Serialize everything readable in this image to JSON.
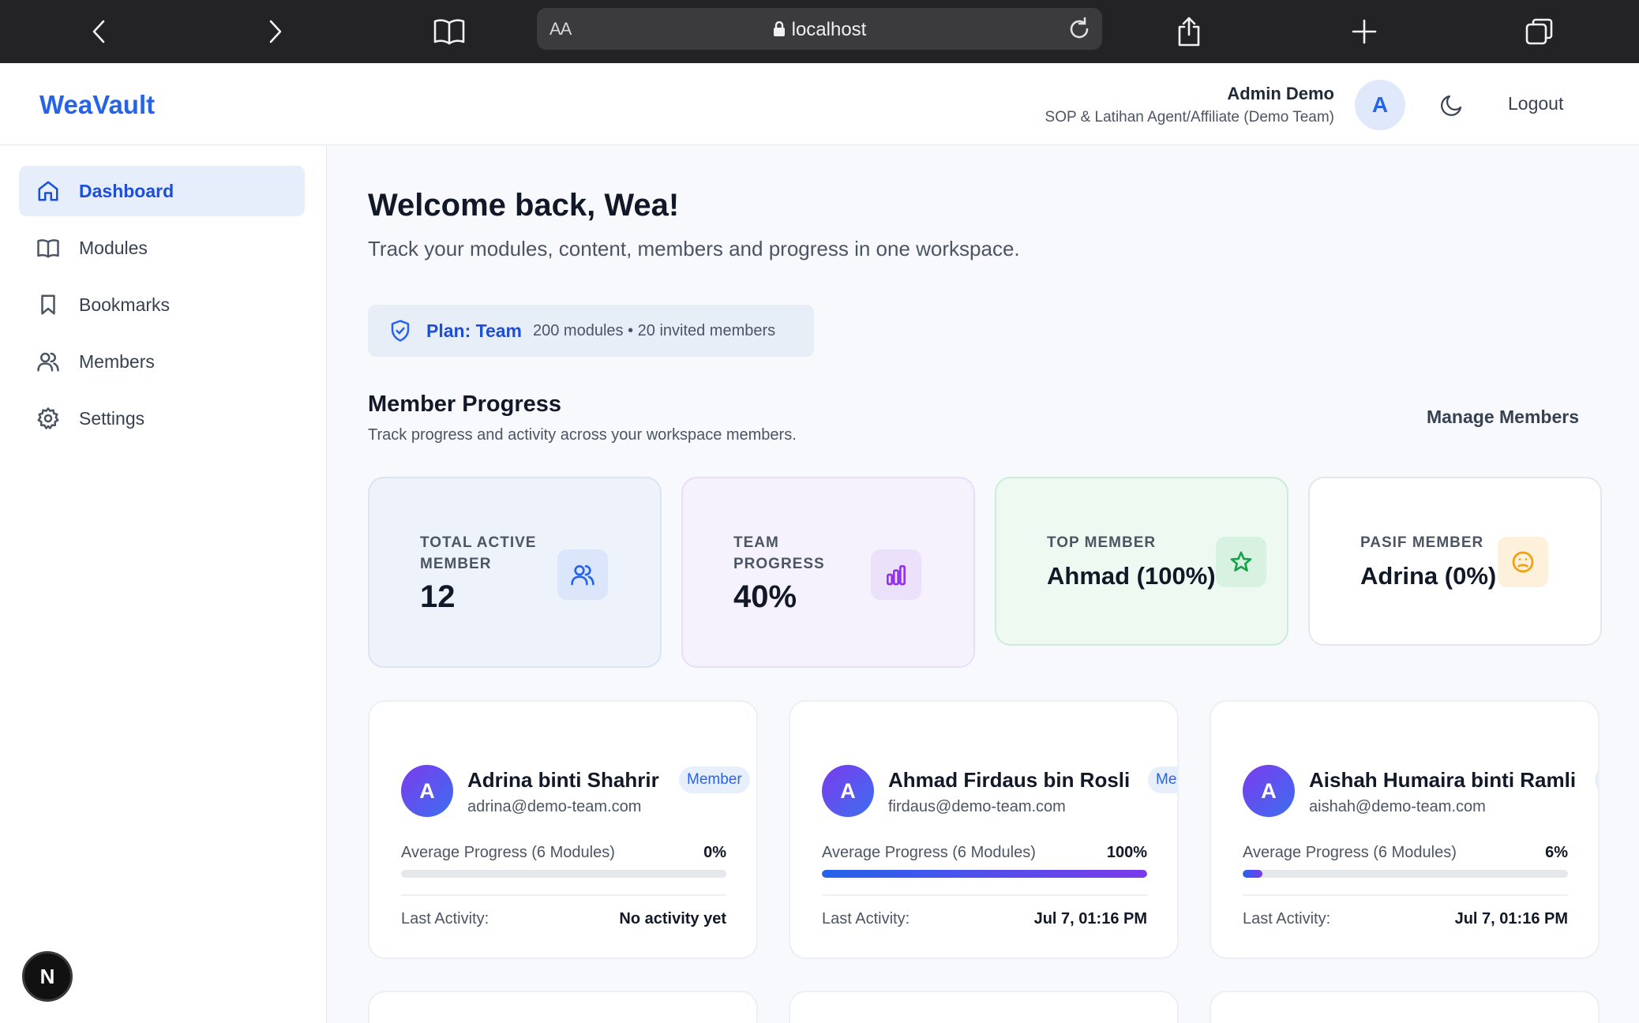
{
  "browser": {
    "url_aa": "AA",
    "host": "localhost"
  },
  "header": {
    "logo": "WeaVault",
    "user_name": "Admin Demo",
    "user_role": "SOP & Latihan Agent/Affiliate (Demo Team)",
    "avatar_initial": "A",
    "logout_label": "Logout"
  },
  "sidebar": {
    "items": [
      {
        "label": "Dashboard",
        "icon": "home-icon",
        "active": true
      },
      {
        "label": "Modules",
        "icon": "book-icon",
        "active": false
      },
      {
        "label": "Bookmarks",
        "icon": "bookmark-icon",
        "active": false
      },
      {
        "label": "Members",
        "icon": "users-icon",
        "active": false
      },
      {
        "label": "Settings",
        "icon": "gear-icon",
        "active": false
      }
    ],
    "fab_label": "N"
  },
  "main": {
    "welcome": "Welcome back, Wea!",
    "subtitle": "Track your modules, content, members and progress in one workspace.",
    "plan_label": "Plan: Team",
    "plan_desc": "200 modules • 20 invited members",
    "section_title": "Member Progress",
    "section_subtitle": "Track progress and activity across your workspace members.",
    "manage_label": "Manage Members"
  },
  "stats": [
    {
      "label": "Total Active Member",
      "value": "12",
      "icon": "users-icon",
      "bg": "#eef3fb",
      "accent": "#2563eb",
      "icon_bg": "#dbe6fa"
    },
    {
      "label": "Team Progress",
      "value": "40%",
      "icon": "bar-chart-icon",
      "bg": "#f5f1fd",
      "accent": "#9333ea",
      "icon_bg": "#ece1fb"
    },
    {
      "label": "Top Member",
      "value": "Ahmad (100%)",
      "icon": "star-icon",
      "bg": "#eef9f2",
      "accent": "#16a34a",
      "icon_bg": "#d7f2e1"
    },
    {
      "label": "Pasif Member",
      "value": "Adrina (0%)",
      "icon": "frown-icon",
      "bg": "#ffffff",
      "accent": "#f59e0b",
      "icon_bg": "#fdf1dc"
    }
  ],
  "members": [
    {
      "initial": "A",
      "name": "Adrina binti Shahrir",
      "email": "adrina@demo-team.com",
      "role": "Member",
      "progress_label": "Average Progress (6 Modules)",
      "progress": 0,
      "progress_text": "0%",
      "last_label": "Last Activity:",
      "last_value": "No activity yet"
    },
    {
      "initial": "A",
      "name": "Ahmad Firdaus bin Rosli",
      "email": "firdaus@demo-team.com",
      "role": "Member",
      "progress_label": "Average Progress (6 Modules)",
      "progress": 100,
      "progress_text": "100%",
      "last_label": "Last Activity:",
      "last_value": "Jul 7, 01:16 PM"
    },
    {
      "initial": "A",
      "name": "Aishah Humaira binti Ramli",
      "email": "aishah@demo-team.com",
      "role": "Member",
      "progress_label": "Average Progress (6 Modules)",
      "progress": 6,
      "progress_text": "6%",
      "last_label": "Last Activity:",
      "last_value": "Jul 7, 01:16 PM"
    }
  ]
}
